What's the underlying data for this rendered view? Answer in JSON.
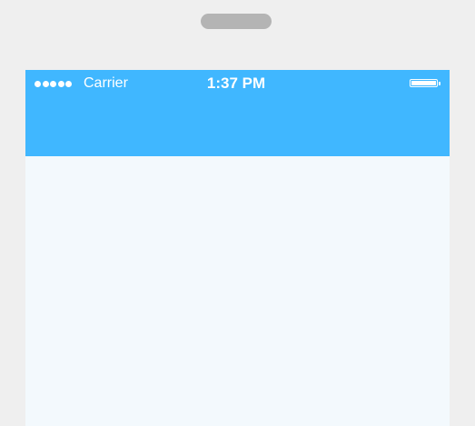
{
  "device": {
    "frame_color": "#efefef",
    "speaker_color": "#b4b4b4"
  },
  "status_bar": {
    "signal_icon": "signal-dots",
    "signal_bars": 5,
    "carrier": "Carrier",
    "time": "1:37 PM",
    "battery_icon": "battery-full",
    "battery_level": 1.0
  },
  "header": {
    "background_color": "#40b7ff"
  },
  "content": {
    "background_color": "#f3f9fd"
  }
}
